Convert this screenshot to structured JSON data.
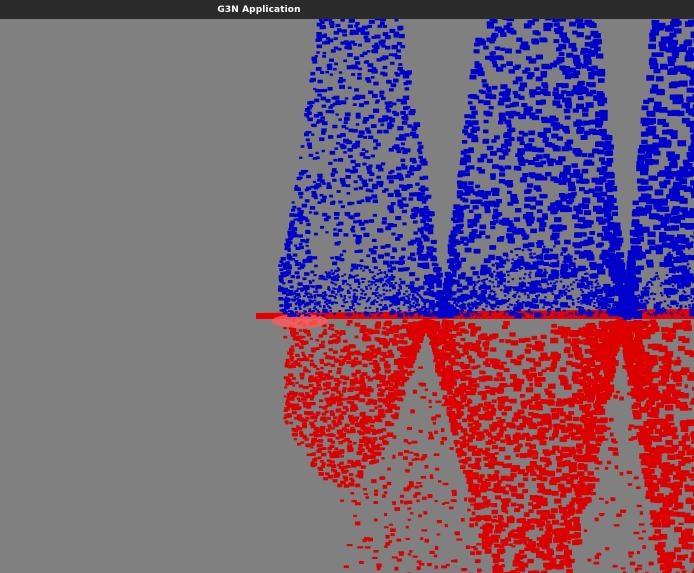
{
  "window": {
    "title": "G3N Application"
  },
  "scene": {
    "background_color": "#808080",
    "upper_surface_color": "#0000cc",
    "lower_surface_color": "#dd0000",
    "plane_color": "#e60000"
  }
}
